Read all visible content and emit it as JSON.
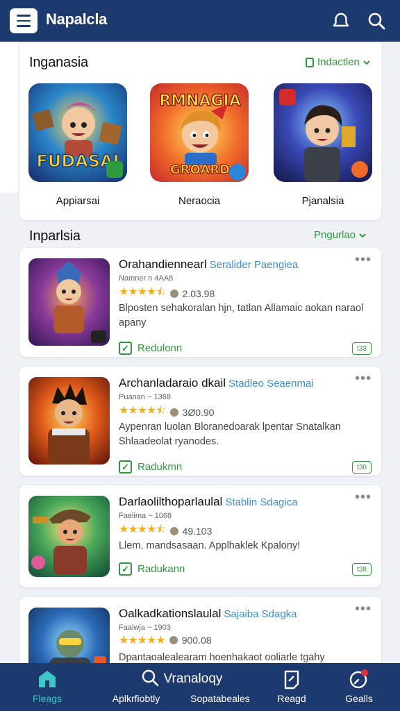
{
  "header": {
    "title": "Napalcla",
    "menu_icon": "hamburger-menu-icon",
    "icons": [
      "notification-bell-icon",
      "search-icon"
    ]
  },
  "featured": {
    "title": "Inganasia",
    "link_label": "Indactlen",
    "items": [
      {
        "label": "Appiarsai",
        "art_text": "FUDASAI"
      },
      {
        "label": "Neraocia",
        "art_text_top": "RMNAGIA",
        "art_text_bottom": "GROARD"
      },
      {
        "label": "Pjanalsia"
      }
    ]
  },
  "list": {
    "title": "Inparlsia",
    "link_label": "Pngurlao",
    "rows": [
      {
        "name": "Orahandiennearl",
        "developer": "Seralider Paengiea",
        "meta": "Namner n 4AA8",
        "rating": 4.5,
        "count": "2.03.98",
        "description": "Blposten sehakoralan hjn, tatlan Allamaic aokan naraol apany",
        "status": "Redulonn",
        "badge": "t33"
      },
      {
        "name": "Archanladaraio dkail",
        "developer": "Stadleo Seaenmai",
        "meta": "Puanan ~ 1368",
        "rating": 4.5,
        "count": "3Ø0.90",
        "description": "Aypenran luolan Bloranedoarak lpentar Snatalkan Shlaadeolat ryanodes.",
        "status": "Radukmn",
        "badge": "t30"
      },
      {
        "name": "Darlaolilthoparlaulal",
        "developer": "Stablin Sdagica",
        "meta": "Faelima ~ 1068",
        "rating": 4.5,
        "count": "49.103",
        "description": "Llem. mandsasaan. Applhaklek Kpalony!",
        "status": "Radukann",
        "badge": "t38"
      },
      {
        "name": "Oalkadkationslaulal",
        "developer": "Sajaiba Sdagka",
        "meta": "Faaiwja ~ 1903",
        "rating": 5,
        "count": "900.08",
        "description": "Dpantaoalealearam hoenhakaot ooliarle tgahy",
        "status": "",
        "badge": ""
      }
    ]
  },
  "bottom_nav": [
    {
      "label": "Fleags",
      "icon": "home-icon",
      "active": true
    },
    {
      "label": "Aplkrfiobtly",
      "icon": "",
      "active": false
    },
    {
      "label": "Vranaloqy",
      "icon": "search-icon",
      "active": false
    },
    {
      "label": "Sopatabeales",
      "icon": "",
      "active": false
    },
    {
      "label": "Reagd",
      "icon": "edit-icon",
      "active": false
    },
    {
      "label": "Gealls",
      "icon": "notification-icon",
      "active": false
    }
  ],
  "colors": {
    "primary": "#1d3a6e",
    "accent_green": "#2e9a3c",
    "accent_blue": "#3b8fd0",
    "active_nav": "#3ec7c7",
    "star": "#f2b01e"
  }
}
